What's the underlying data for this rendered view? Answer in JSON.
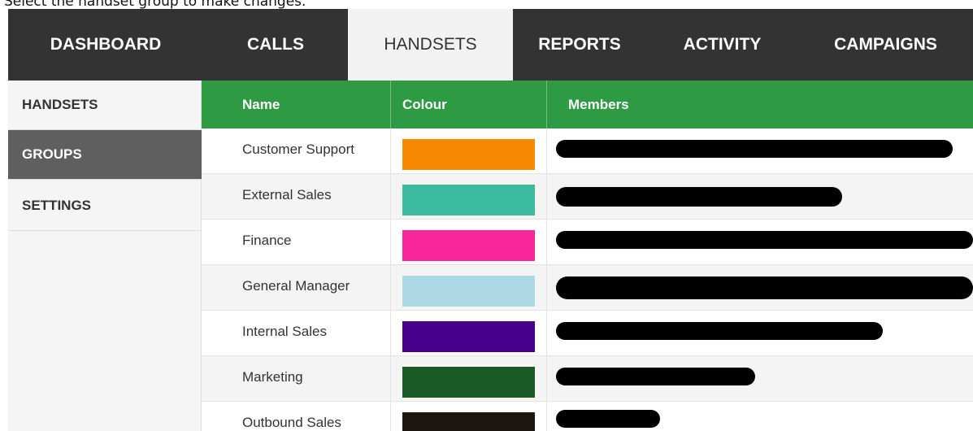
{
  "caption": "Select the handset group to make changes.",
  "topnav": {
    "tabs": [
      {
        "label": "DASHBOARD",
        "active": false
      },
      {
        "label": "CALLS",
        "active": false
      },
      {
        "label": "HANDSETS",
        "active": true
      },
      {
        "label": "REPORTS",
        "active": false
      },
      {
        "label": "ACTIVITY",
        "active": false
      },
      {
        "label": "CAMPAIGNS",
        "active": false
      }
    ]
  },
  "sidebar": {
    "items": [
      {
        "label": "HANDSETS",
        "active": false
      },
      {
        "label": "GROUPS",
        "active": true
      },
      {
        "label": "SETTINGS",
        "active": false
      }
    ]
  },
  "table": {
    "columns": [
      "Name",
      "Colour",
      "Members"
    ],
    "rows": [
      {
        "name": "Customer Support",
        "colour": "#f68a00",
        "members": "",
        "redacted": true
      },
      {
        "name": "External Sales",
        "colour": "#3bba9e",
        "members": "",
        "redacted": true
      },
      {
        "name": "Finance",
        "colour": "#f7269a",
        "members": "",
        "redacted": true
      },
      {
        "name": "General Manager",
        "colour": "#add8e6",
        "members": "",
        "redacted": true
      },
      {
        "name": "Internal Sales",
        "colour": "#46008c",
        "members": "",
        "redacted": true
      },
      {
        "name": "Marketing",
        "colour": "#1a5a26",
        "members": "",
        "redacted": true
      },
      {
        "name": "Outbound Sales",
        "colour": "#1c1511",
        "members": "",
        "redacted": true
      }
    ]
  },
  "colors": {
    "nav_bg": "#333333",
    "header_green": "#2e9a43",
    "sidebar_active": "#5f5f5f"
  }
}
